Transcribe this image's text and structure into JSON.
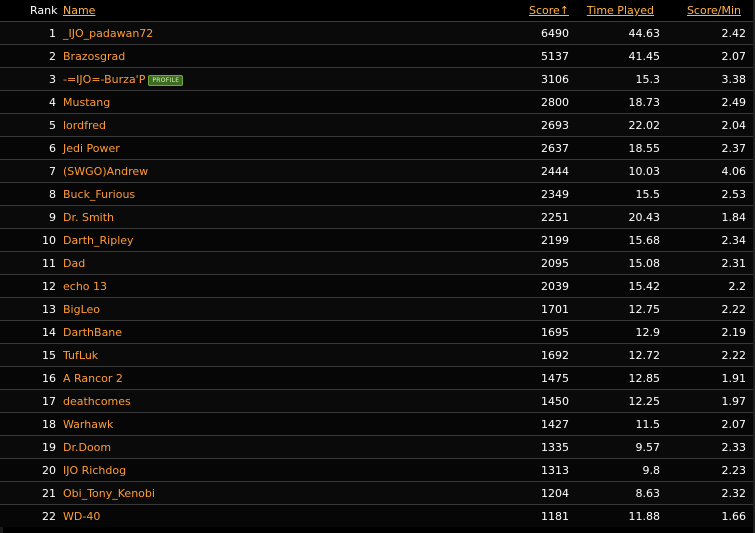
{
  "header": {
    "rank": "Rank",
    "name": "Name",
    "score": "Score↑",
    "time_played": "Time Played",
    "score_per_min": "Score/Min"
  },
  "rows": [
    {
      "rank": "1",
      "name": "_IJO_padawan72",
      "score": "6490",
      "time": "44.63",
      "spm": "2.42"
    },
    {
      "rank": "2",
      "name": "Brazosgrad",
      "score": "5137",
      "time": "41.45",
      "spm": "2.07"
    },
    {
      "rank": "3",
      "name": "-=IJO=-Burza'P",
      "badge": "PROFILE",
      "score": "3106",
      "time": "15.3",
      "spm": "3.38"
    },
    {
      "rank": "4",
      "name": "Mustang",
      "score": "2800",
      "time": "18.73",
      "spm": "2.49"
    },
    {
      "rank": "5",
      "name": "lordfred",
      "score": "2693",
      "time": "22.02",
      "spm": "2.04"
    },
    {
      "rank": "6",
      "name": "Jedi Power",
      "score": "2637",
      "time": "18.55",
      "spm": "2.37"
    },
    {
      "rank": "7",
      "name": "(SWGO)Andrew",
      "score": "2444",
      "time": "10.03",
      "spm": "4.06"
    },
    {
      "rank": "8",
      "name": "Buck_Furious",
      "score": "2349",
      "time": "15.5",
      "spm": "2.53"
    },
    {
      "rank": "9",
      "name": "Dr. Smith",
      "score": "2251",
      "time": "20.43",
      "spm": "1.84"
    },
    {
      "rank": "10",
      "name": "Darth_Ripley",
      "score": "2199",
      "time": "15.68",
      "spm": "2.34"
    },
    {
      "rank": "11",
      "name": "Dad",
      "score": "2095",
      "time": "15.08",
      "spm": "2.31"
    },
    {
      "rank": "12",
      "name": "echo 13",
      "score": "2039",
      "time": "15.42",
      "spm": "2.2"
    },
    {
      "rank": "13",
      "name": "BigLeo",
      "score": "1701",
      "time": "12.75",
      "spm": "2.22"
    },
    {
      "rank": "14",
      "name": "DarthBane",
      "score": "1695",
      "time": "12.9",
      "spm": "2.19"
    },
    {
      "rank": "15",
      "name": "TufLuk",
      "score": "1692",
      "time": "12.72",
      "spm": "2.22"
    },
    {
      "rank": "16",
      "name": "A Rancor 2",
      "score": "1475",
      "time": "12.85",
      "spm": "1.91"
    },
    {
      "rank": "17",
      "name": "deathcomes",
      "score": "1450",
      "time": "12.25",
      "spm": "1.97"
    },
    {
      "rank": "18",
      "name": "Warhawk",
      "score": "1427",
      "time": "11.5",
      "spm": "2.07"
    },
    {
      "rank": "19",
      "name": "Dr.Doom",
      "score": "1335",
      "time": "9.57",
      "spm": "2.33"
    },
    {
      "rank": "20",
      "name": "IJO Richdog",
      "score": "1313",
      "time": "9.8",
      "spm": "2.23"
    },
    {
      "rank": "21",
      "name": "Obi_Tony_Kenobi",
      "score": "1204",
      "time": "8.63",
      "spm": "2.32"
    },
    {
      "rank": "22",
      "name": "WD-40",
      "score": "1181",
      "time": "11.88",
      "spm": "1.66"
    }
  ],
  "colors": {
    "background": "#000000",
    "link": "#ff9b33",
    "header_link": "#ffb347",
    "text": "#ffffff",
    "row_border": "#3a3a3a",
    "badge_bg": "#3d6b1f"
  }
}
